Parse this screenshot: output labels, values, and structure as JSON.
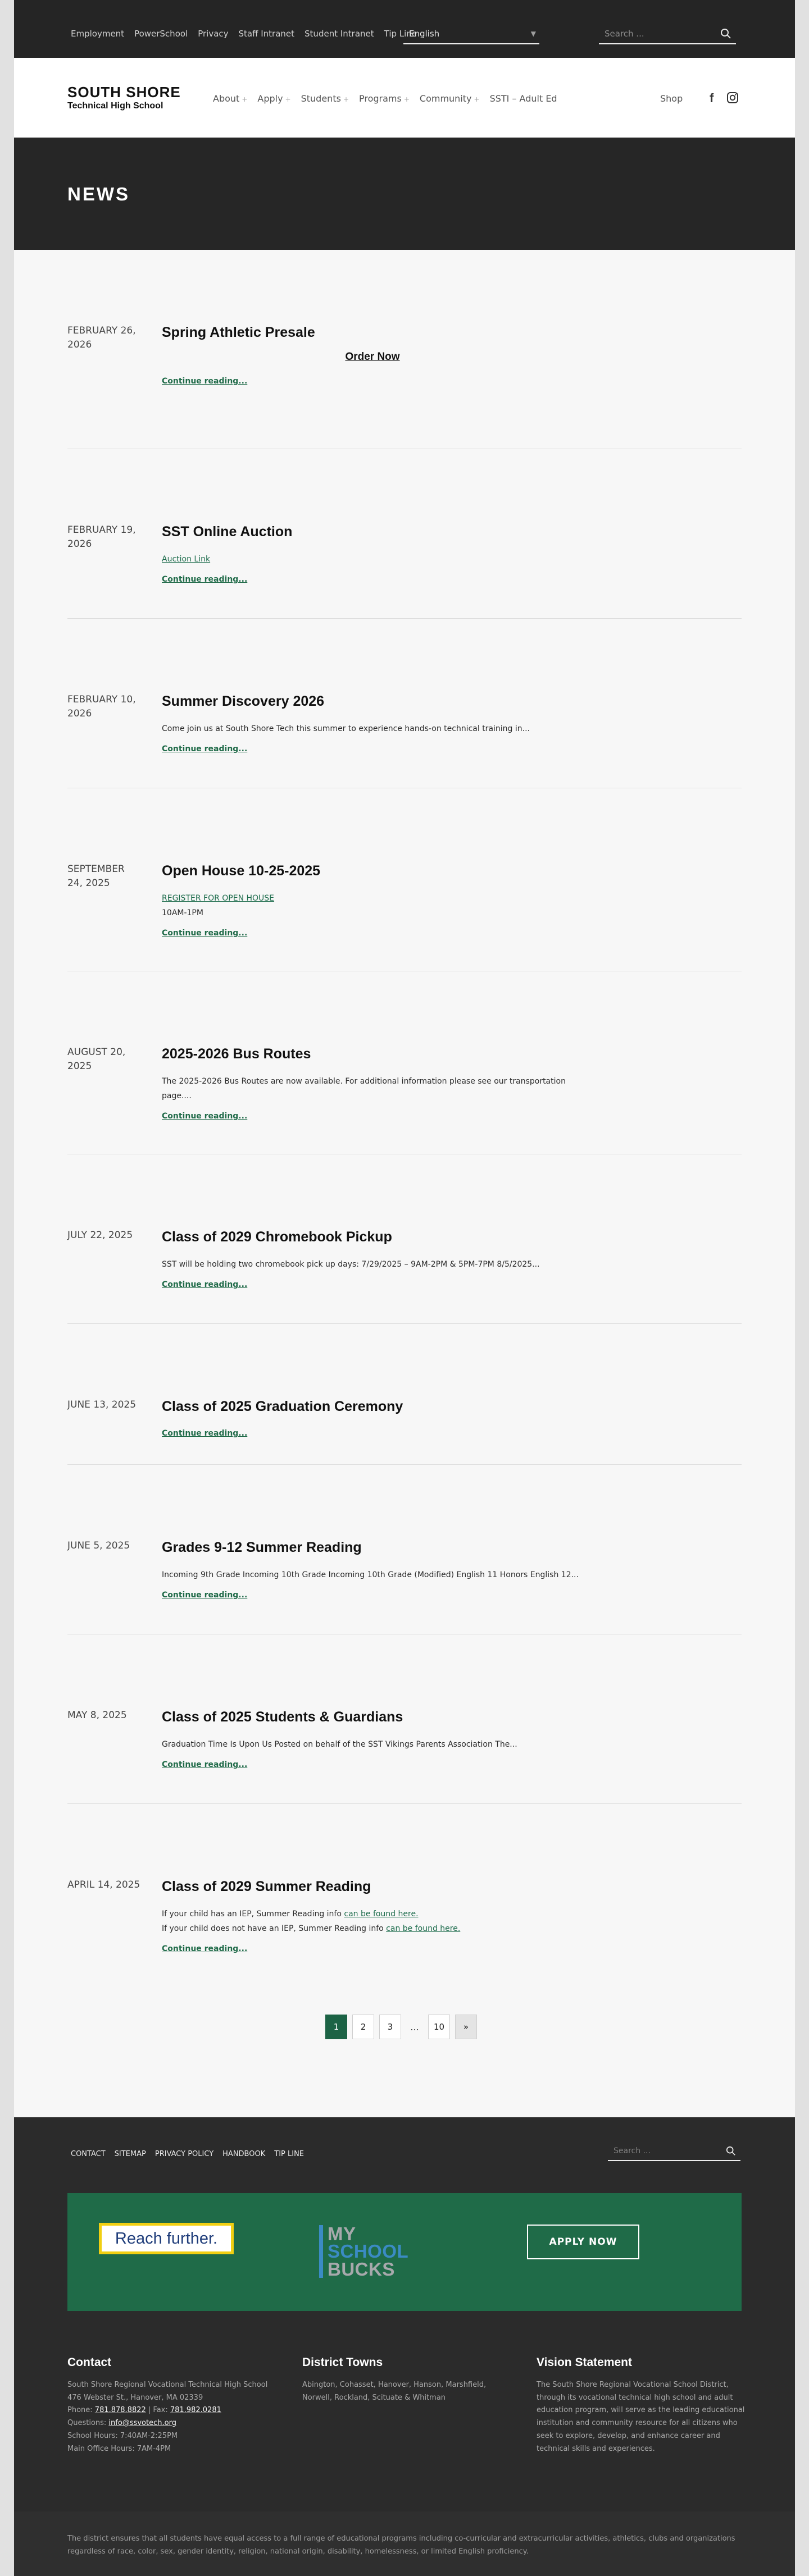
{
  "utility": {
    "links": [
      "Employment",
      "PowerSchool",
      "Privacy",
      "Staff Intranet",
      "Student Intranet",
      "Tip Line"
    ],
    "language": "English",
    "search_placeholder": "Search ..."
  },
  "header": {
    "logo_line1": "SOUTH SHORE",
    "logo_line2": "Technical High School",
    "nav": [
      {
        "label": "About",
        "plus": "+"
      },
      {
        "label": "Apply",
        "plus": "+"
      },
      {
        "label": "Students",
        "plus": "+"
      },
      {
        "label": "Programs",
        "plus": "+"
      },
      {
        "label": "Community",
        "plus": "+"
      },
      {
        "label": "SSTI – Adult Ed",
        "plus": ""
      }
    ],
    "shop": "Shop",
    "facebook": "f"
  },
  "banner": {
    "title": "NEWS"
  },
  "posts": [
    {
      "date": "February 26, 2026",
      "title": "Spring Athletic Presale",
      "center_link": "Order Now",
      "more": "Continue reading..."
    },
    {
      "date": "February 19, 2026",
      "title": "SST Online Auction",
      "link": "Auction Link",
      "more": "Continue reading..."
    },
    {
      "date": "February 10, 2026",
      "title": "Summer Discovery 2026",
      "excerpt": "Come join us at South Shore Tech this summer to experience hands-on technical training in...",
      "more": "Continue reading..."
    },
    {
      "date": "September 24, 2025",
      "title": "Open House 10-25-2025",
      "caps_link": "Register for Open House",
      "excerpt": "10AM-1PM",
      "more": "Continue reading..."
    },
    {
      "date": "August 20, 2025",
      "title": "2025-2026 Bus Routes",
      "excerpt": "The 2025-2026 Bus Routes are now available. For additional information please see our transportation page....",
      "more": "Continue reading..."
    },
    {
      "date": "July 22, 2025",
      "title": "Class of 2029 Chromebook Pickup",
      "excerpt": "SST will be holding two chromebook pick up days: 7/29/2025 – 9AM-2PM & 5PM-7PM 8/5/2025...",
      "more": "Continue reading..."
    },
    {
      "date": "June 13, 2025",
      "title": "Class of 2025 Graduation Ceremony",
      "more": "Continue reading..."
    },
    {
      "date": "June 5, 2025",
      "title": "Grades 9-12 Summer Reading",
      "excerpt": "Incoming 9th Grade Incoming 10th Grade Incoming 10th Grade (Modified) English 11 Honors English 12...",
      "more": "Continue reading..."
    },
    {
      "date": "May 8, 2025",
      "title": "Class of 2025 Students & Guardians",
      "excerpt": "Graduation Time Is Upon Us Posted on behalf of the SST Vikings Parents Association The...",
      "more": "Continue reading..."
    },
    {
      "date": "April 14, 2025",
      "title": "Class of 2029 Summer Reading",
      "lines": [
        {
          "text": "If your child has an IEP, Summer Reading info ",
          "link": "can be found here."
        },
        {
          "text": "If your child does not have an IEP, Summer Reading info ",
          "link": "can be found here."
        }
      ],
      "more": "Continue reading..."
    }
  ],
  "pagination": {
    "pages": [
      "1",
      "2",
      "3"
    ],
    "ellipsis": "...",
    "last": "10",
    "next": "»"
  },
  "footer": {
    "links": [
      "Contact",
      "Sitemap",
      "Privacy Policy",
      "Handbook",
      "Tip Line"
    ],
    "search_placeholder": "Search ...",
    "reach_further": "Reach further.",
    "myschool_line1": "MY",
    "myschool_line2": "SCHOOL",
    "myschool_line3": "BUCKS",
    "apply_now": "APPLY NOW",
    "contact": {
      "heading": "Contact",
      "line1": "South Shore Regional Vocational Technical High School",
      "line2": "476 Webster St., Hanover, MA 02339",
      "phone_label": "Phone: ",
      "phone": "781.878.8822",
      "fax_label": " | Fax: ",
      "fax": "781.982.0281",
      "questions_label": "Questions: ",
      "email": "info@ssvotech.org",
      "hours": "School Hours: 7:40AM-2:25PM",
      "office_hours": "Main Office Hours: 7AM-4PM"
    },
    "towns": {
      "heading": "District Towns",
      "text": "Abington, Cohasset, Hanover, Hanson, Marshfield, Norwell, Rockland, Scituate & Whitman"
    },
    "vision": {
      "heading": "Vision Statement",
      "text": "The South Shore Regional Vocational School District, through its vocational technical high school and adult education program, will serve as the leading educational institution and community resource for all citizens who seek to explore, develop, and enhance career and technical skills and experiences."
    },
    "disclaimer": "The district ensures that all students have equal access to a full range of educational programs including co-curricular and extracurricular activities, athletics, clubs and organizations regardless of race, color, sex, gender identity, religion, national origin, disability, homelessness, or limited English proficiency."
  }
}
